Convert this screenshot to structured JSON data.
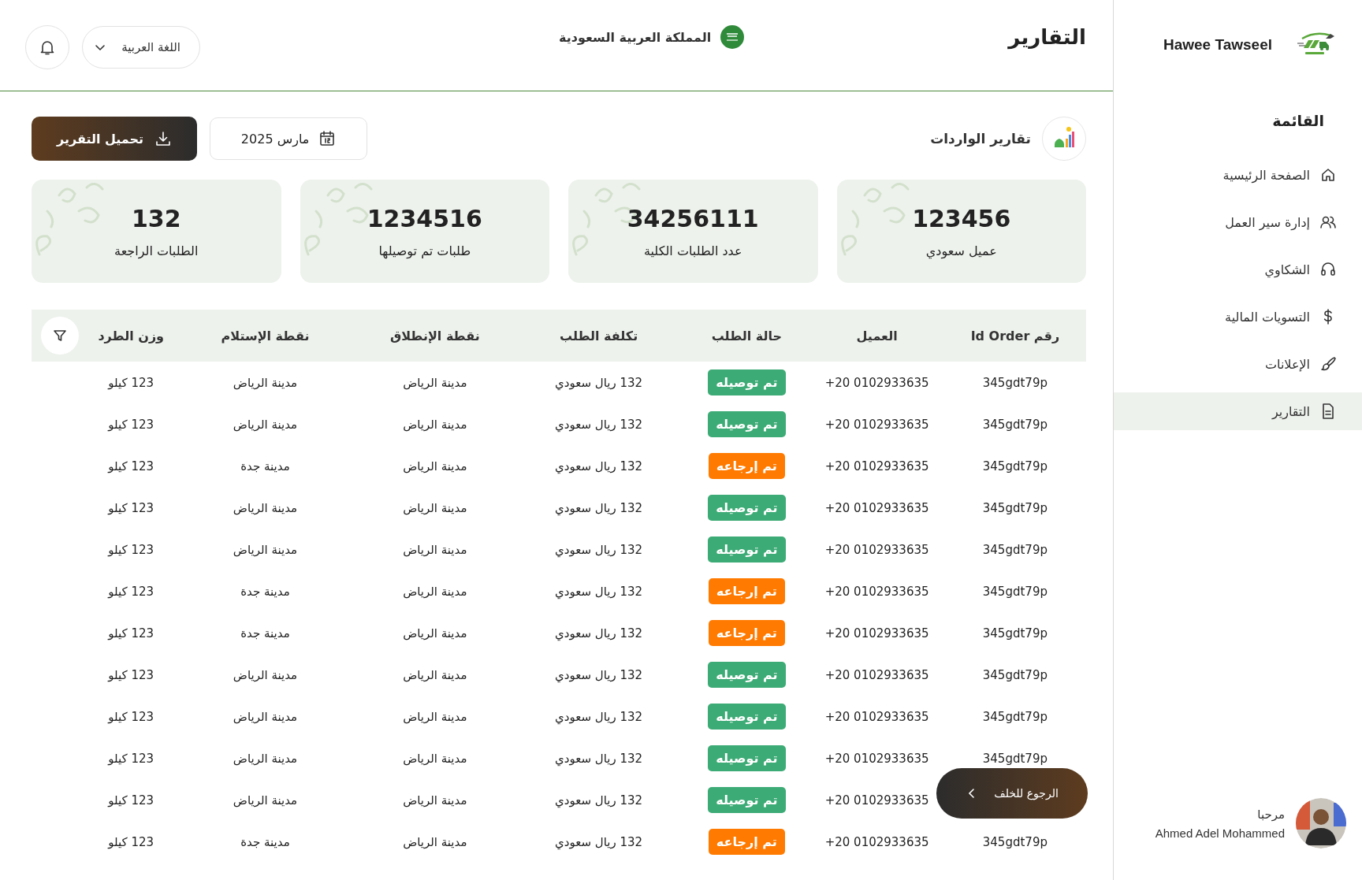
{
  "header": {
    "title": "التقارير",
    "country": "المملكة العربية السعودية",
    "language": "اللغة العربية"
  },
  "toolbar": {
    "section_title": "تقارير الواردات",
    "date": "مارس 2025",
    "download_button": "تحميل التقرير"
  },
  "stats": [
    {
      "value": "123456",
      "label": "عميل سعودي"
    },
    {
      "value": "34256111",
      "label": "عدد الطلبات الكلية"
    },
    {
      "value": "1234516",
      "label": "طلبات تم توصيلها"
    },
    {
      "value": "132",
      "label": "الطلبات الراجعة"
    }
  ],
  "table": {
    "columns": [
      "رقم Id Order",
      "العميل",
      "حالة الطلب",
      "تكلفة الطلب",
      "نقطة الإنطلاق",
      "نقطة الإستلام",
      "وزن الطرد"
    ],
    "rows": [
      {
        "order_id": "345gdt79p",
        "client": "+20 0102933635",
        "status": {
          "label": "تم توصيله",
          "color": "#3dab76"
        },
        "cost": "132 ريال سعودي",
        "origin": "مدينة الرياض",
        "destination": "مدينة الرياض",
        "weight": "123 كيلو"
      },
      {
        "order_id": "345gdt79p",
        "client": "+20 0102933635",
        "status": {
          "label": "تم توصيله",
          "color": "#3dab76"
        },
        "cost": "132 ريال سعودي",
        "origin": "مدينة الرياض",
        "destination": "مدينة الرياض",
        "weight": "123 كيلو"
      },
      {
        "order_id": "345gdt79p",
        "client": "+20 0102933635",
        "status": {
          "label": "تم إرجاعه",
          "color": "#ff7a00"
        },
        "cost": "132 ريال سعودي",
        "origin": "مدينة الرياض",
        "destination": "مدينة جدة",
        "weight": "123 كيلو"
      },
      {
        "order_id": "345gdt79p",
        "client": "+20 0102933635",
        "status": {
          "label": "تم توصيله",
          "color": "#3dab76"
        },
        "cost": "132 ريال سعودي",
        "origin": "مدينة الرياض",
        "destination": "مدينة الرياض",
        "weight": "123 كيلو"
      },
      {
        "order_id": "345gdt79p",
        "client": "+20 0102933635",
        "status": {
          "label": "تم توصيله",
          "color": "#3dab76"
        },
        "cost": "132 ريال سعودي",
        "origin": "مدينة الرياض",
        "destination": "مدينة الرياض",
        "weight": "123 كيلو"
      },
      {
        "order_id": "345gdt79p",
        "client": "+20 0102933635",
        "status": {
          "label": "تم إرجاعه",
          "color": "#ff7a00"
        },
        "cost": "132 ريال سعودي",
        "origin": "مدينة الرياض",
        "destination": "مدينة جدة",
        "weight": "123 كيلو"
      },
      {
        "order_id": "345gdt79p",
        "client": "+20 0102933635",
        "status": {
          "label": "تم إرجاعه",
          "color": "#ff7a00"
        },
        "cost": "132 ريال سعودي",
        "origin": "مدينة الرياض",
        "destination": "مدينة جدة",
        "weight": "123 كيلو"
      },
      {
        "order_id": "345gdt79p",
        "client": "+20 0102933635",
        "status": {
          "label": "تم توصيله",
          "color": "#3dab76"
        },
        "cost": "132 ريال سعودي",
        "origin": "مدينة الرياض",
        "destination": "مدينة الرياض",
        "weight": "123 كيلو"
      },
      {
        "order_id": "345gdt79p",
        "client": "+20 0102933635",
        "status": {
          "label": "تم توصيله",
          "color": "#3dab76"
        },
        "cost": "132 ريال سعودي",
        "origin": "مدينة الرياض",
        "destination": "مدينة الرياض",
        "weight": "123 كيلو"
      },
      {
        "order_id": "345gdt79p",
        "client": "+20 0102933635",
        "status": {
          "label": "تم توصيله",
          "color": "#3dab76"
        },
        "cost": "132 ريال سعودي",
        "origin": "مدينة الرياض",
        "destination": "مدينة الرياض",
        "weight": "123 كيلو"
      },
      {
        "client": "+20 0102933635",
        "status": {
          "label": "تم توصيله",
          "color": "#3dab76"
        },
        "cost": "132 ريال سعودي",
        "origin": "مدينة الرياض",
        "destination": "مدينة الرياض",
        "weight": "123 كيلو"
      },
      {
        "order_id": "345gdt79p",
        "client": "+20 0102933635",
        "status": {
          "label": "تم إرجاعه",
          "color": "#ff7a00"
        },
        "cost": "132 ريال سعودي",
        "origin": "مدينة الرياض",
        "destination": "مدينة جدة",
        "weight": "123 كيلو"
      }
    ]
  },
  "back_button": "الرجوع للخلف",
  "sidebar": {
    "brand": "Hawee Tawseel",
    "menu_title": "القائمة",
    "items": [
      {
        "label": "الصفحة الرئيسية",
        "selected": false
      },
      {
        "label": "إدارة سير العمل",
        "selected": false
      },
      {
        "label": "الشكاوي",
        "selected": false
      },
      {
        "label": "التسويات المالية",
        "selected": false
      },
      {
        "label": "الإعلانات",
        "selected": false
      },
      {
        "label": "التقارير",
        "selected": true
      }
    ],
    "user": {
      "greeting": "مرحبا",
      "name": "Ahmed Adel Mohammed"
    }
  }
}
